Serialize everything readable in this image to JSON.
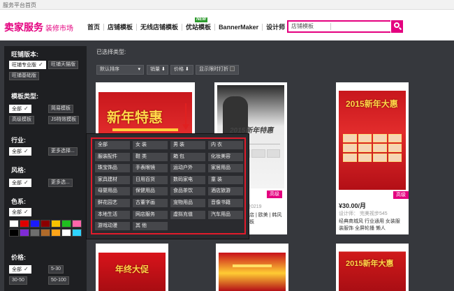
{
  "breadcrumb": "服务平台首页",
  "logo": {
    "brand": "卖家服务",
    "sub": "装修市场"
  },
  "nav": [
    {
      "label": "首页",
      "badge": ""
    },
    {
      "label": "店铺模板",
      "badge": ""
    },
    {
      "label": "无线店铺模板",
      "badge": ""
    },
    {
      "label": "优站模板",
      "badge": "NEW"
    },
    {
      "label": "BannerMaker",
      "badge": ""
    },
    {
      "label": "设计师",
      "badge": ""
    }
  ],
  "search": {
    "scope": "店铺模板"
  },
  "sidebar": {
    "version_title": "旺铺版本:",
    "versions": [
      {
        "label": "旺铺专业版",
        "selected": true
      },
      {
        "label": "旺铺天猫版",
        "selected": false
      },
      {
        "label": "旺铺基础版",
        "selected": false
      }
    ],
    "type_title": "模板类型:",
    "types": [
      {
        "label": "全部",
        "selected": true
      },
      {
        "label": "简易模板",
        "selected": false
      },
      {
        "label": "高级模板",
        "selected": false
      },
      {
        "label": "JS特效模板",
        "selected": false
      }
    ],
    "industry_title": "行业:",
    "industry": [
      {
        "label": "全部",
        "selected": true
      },
      {
        "label": "更多选择...",
        "selected": false
      }
    ],
    "style_title": "风格:",
    "style": [
      {
        "label": "全部",
        "selected": true
      },
      {
        "label": "更多选...",
        "selected": false
      }
    ],
    "color_title": "色系:",
    "color_all": "全部",
    "swatches": [
      "#ffffff",
      "#e00000",
      "#1a1aff",
      "#8c0000",
      "#f5c400",
      "#1fbf1f",
      "#ff66aa",
      "#000000",
      "#7f2bd6",
      "#6e6e6e",
      "#b06a2a",
      "#ffa51a",
      "#ffffff",
      "#2ed3ff"
    ],
    "price_title": "价格:",
    "prices": [
      {
        "label": "全部",
        "selected": true
      },
      {
        "label": "5-30",
        "selected": false
      },
      {
        "label": "30-50",
        "selected": false
      },
      {
        "label": "50-100",
        "selected": false
      }
    ]
  },
  "content": {
    "selected_title": "已选择类型:",
    "sort": {
      "default": "默认排序",
      "sales": "销量",
      "price": "价格",
      "limited": "显示限时打折"
    }
  },
  "cards": [
    {
      "poster": "新年特惠",
      "price": "",
      "meta": "",
      "desc": "",
      "tag": ""
    },
    {
      "poster": "2015新年特惠",
      "price": "",
      "meta": "设0219",
      "desc": "店 | 欧美 | 韩风\n板",
      "tag": ""
    },
    {
      "poster": "2015新年大惠",
      "price": "¥30.00/月",
      "meta": "设计师： 完美视步545",
      "desc": "经典商城风 行业通用 女装服\n装服饰 全屏轮播 懒人",
      "tag": "高级"
    },
    {
      "poster": "年终大促",
      "price": "",
      "meta": "",
      "desc": "",
      "tag": ""
    },
    {
      "poster": "",
      "price": "",
      "meta": "",
      "desc": "",
      "tag": ""
    },
    {
      "poster": "2015新年大惠",
      "price": "",
      "meta": "",
      "desc": "",
      "tag": ""
    }
  ],
  "card_tags": {
    "first": "高级",
    "second": "高级"
  },
  "dropdown": {
    "items": [
      "全部",
      "女 装",
      "男 装",
      "内 衣",
      "服装配件",
      "鞋 类",
      "箱 包",
      "化妆美容",
      "珠宝饰品",
      "手表眼镜",
      "运动户外",
      "家居用品",
      "家具建材",
      "日用百货",
      "数码家电",
      "童 装",
      "母婴用品",
      "保健用品",
      "食品茶饮",
      "酒店旅游",
      "鲜花园艺",
      "古董字画",
      "宠物用品",
      "音像书籍",
      "本地生活",
      "网店服务",
      "虚拟充值",
      "汽车用品",
      "游戏动漫",
      "其 他"
    ]
  }
}
